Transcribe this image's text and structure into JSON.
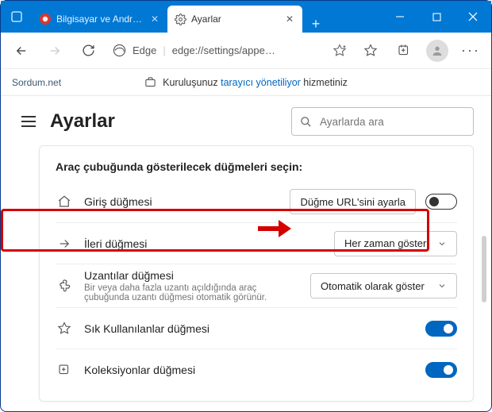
{
  "titlebar": {
    "tabs": [
      {
        "label": "Bilgisayar ve Android",
        "active": false
      },
      {
        "label": "Ayarlar",
        "active": true
      }
    ]
  },
  "toolbar": {
    "product_label": "Edge",
    "url": "edge://settings/appe…"
  },
  "infobar": {
    "watermark": "Sordum.net",
    "prefix": "Kuruluşunuz ",
    "link": "tarayıcı yönetiliyor",
    "suffix": " hizmetiniz"
  },
  "header": {
    "title": "Ayarlar",
    "search_placeholder": "Ayarlarda ara"
  },
  "card": {
    "title": "Araç çubuğunda gösterilecek düğmeleri seçin:",
    "rows": {
      "home": {
        "label": "Giriş düğmesi",
        "button": "Düğme URL'sini ayarla",
        "toggle_on": false
      },
      "forward": {
        "label": "İleri düğmesi",
        "dropdown": "Her zaman göster"
      },
      "extensions": {
        "label": "Uzantılar düğmesi",
        "dropdown": "Otomatik olarak göster",
        "desc": "Bir veya daha fazla uzantı açıldığında araç çubuğunda uzantı düğmesi otomatik görünür."
      },
      "favorites": {
        "label": "Sık Kullanılanlar düğmesi",
        "toggle_on": true
      },
      "collections": {
        "label": "Koleksiyonlar düğmesi",
        "toggle_on": true
      }
    }
  }
}
